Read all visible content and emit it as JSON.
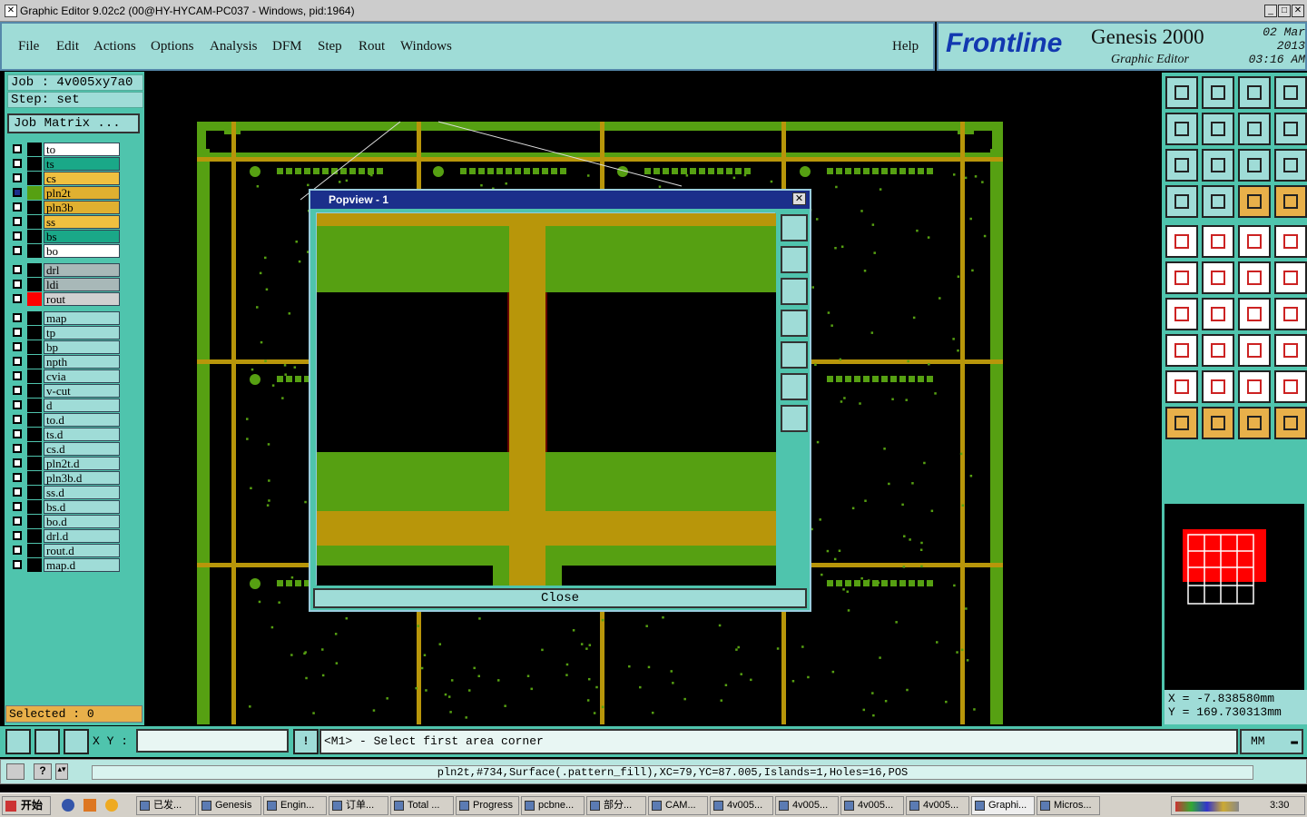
{
  "window": {
    "title": "Graphic Editor 9.02c2 (00@HY-HYCAM-PC037 - Windows, pid:1964)"
  },
  "menu": {
    "items": [
      "File",
      "Edit",
      "Actions",
      "Options",
      "Analysis",
      "DFM",
      "Step",
      "Rout",
      "Windows"
    ],
    "help": "Help"
  },
  "brand": {
    "logo": "Frontline",
    "product": "Genesis 2000",
    "subtitle": "Graphic Editor",
    "date": "02 Mar 2013",
    "time": "03:16 AM"
  },
  "job": {
    "job_line": "Job : 4v005xy7a0",
    "step_line": "Step: set",
    "matrix_button": "Job Matrix ..."
  },
  "layers": {
    "group1": [
      "to",
      "ts",
      "cs",
      "pln2t",
      "pln3b",
      "ss",
      "bs",
      "bo"
    ],
    "group2": [
      "drl",
      "ldi",
      "rout"
    ],
    "group3": [
      "map",
      "tp",
      "bp",
      "npth",
      "cvia",
      "v-cut",
      "d",
      "to.d",
      "ts.d",
      "cs.d",
      "pln2t.d",
      "pln3b.d",
      "ss.d",
      "bs.d",
      "bo.d",
      "drl.d",
      "rout.d",
      "map.d"
    ]
  },
  "colors": {
    "teal": "#4fc4ad",
    "light_teal": "#9fdcd7",
    "copper_green": "#56a012",
    "gold": "#b8960a",
    "orange": "#e8b04a",
    "red": "#ff0000"
  },
  "selected": "Selected : 0",
  "popview": {
    "title": "Popview - 1",
    "close_label": "Close"
  },
  "coords": {
    "x": "X = -7.838580mm",
    "y": "Y = 169.730313mm"
  },
  "command": {
    "xy_label": "X Y :",
    "xy_value": "",
    "prompt": "<M1> - Select first area corner",
    "units": "MM"
  },
  "status": "pln2t,#734,Surface(.pattern_fill),XC=79,YC=87.005,Islands=1,Holes=16,POS",
  "taskbar": {
    "start": "开始",
    "tasks": [
      "已发...",
      "Genesis",
      "Engin...",
      "订单...",
      "Total ...",
      "Progress",
      "pcbne...",
      "部分...",
      "CAM...",
      "4v005...",
      "4v005...",
      "4v005...",
      "4v005...",
      "Graphi...",
      "Micros..."
    ],
    "clock": "3:30"
  }
}
